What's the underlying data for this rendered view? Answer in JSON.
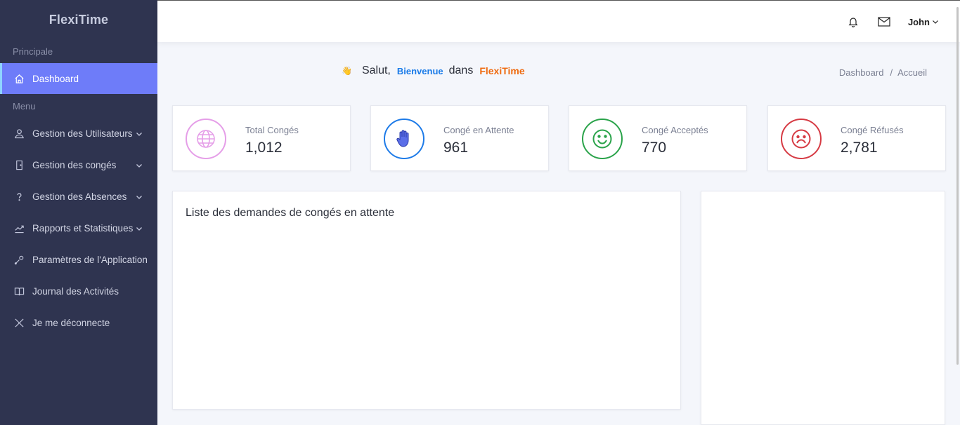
{
  "app": {
    "name": "FlexiTime"
  },
  "sidebar": {
    "section_main": "Principale",
    "section_menu": "Menu",
    "items": [
      {
        "label": "Dashboard",
        "icon": "home-icon",
        "active": true
      },
      {
        "label": "Gestion des Utilisateurs",
        "icon": "user-icon",
        "has_submenu": true
      },
      {
        "label": "Gestion des congés",
        "icon": "door-icon",
        "has_submenu": true
      },
      {
        "label": "Gestion des Absences",
        "icon": "question-icon",
        "has_submenu": true
      },
      {
        "label": "Rapports et Statistiques",
        "icon": "chart-line-icon",
        "has_submenu": true
      },
      {
        "label": "Paramètres de l'Application",
        "icon": "wrench-icon"
      },
      {
        "label": "Journal des Activités",
        "icon": "book-icon"
      },
      {
        "label": "Je me déconnecte",
        "icon": "close-icon"
      }
    ]
  },
  "topbar": {
    "user_name": "John",
    "icons": [
      "bell-icon",
      "mail-icon",
      "chevron-down-icon"
    ]
  },
  "greeting": {
    "icon": "waving-hand-icon",
    "salut": "Salut,",
    "bienvenue": "Bienvenue",
    "dans": "dans",
    "brand": "FlexiTime"
  },
  "breadcrumb": {
    "first": "Dashboard",
    "separator": "/",
    "current": "Accueil"
  },
  "stats": [
    {
      "label": "Total Congés",
      "value": "1,012",
      "icon": "globe-icon",
      "color": "#e59ee8"
    },
    {
      "label": "Congé en Attente",
      "value": "961",
      "icon": "raised-hand-icon",
      "color": "#1e7be8"
    },
    {
      "label": "Congé Acceptés",
      "value": "770",
      "icon": "smile-icon",
      "color": "#2aa34a"
    },
    {
      "label": "Congé Réfusés",
      "value": "2,781",
      "icon": "frown-icon",
      "color": "#d63a43"
    }
  ],
  "pending_panel": {
    "title": "Liste des demandes de congés en attente"
  },
  "colors": {
    "sidebar_bg": "#2f3450",
    "active_item": "#6e7cf9",
    "accent_blue": "#1a7be8",
    "accent_orange": "#ef6b10"
  }
}
